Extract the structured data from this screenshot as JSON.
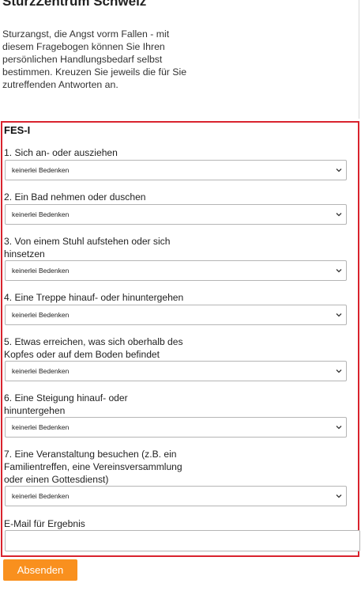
{
  "header": {
    "title": "SturzZentrum Schweiz",
    "intro": "Sturzangst, die Angst vorm Fallen - mit diesem Fragebogen können Sie Ihren persönlichen Handlungsbedarf selbst bestimmen. Kreuzen Sie jeweils die für Sie zutreffenden Antworten an."
  },
  "form": {
    "title": "FES-I",
    "questions": [
      {
        "label": "1. Sich an- oder ausziehen",
        "selected": "keinerlei Bedenken"
      },
      {
        "label": "2. Ein Bad nehmen oder duschen",
        "selected": "keinerlei Bedenken"
      },
      {
        "label": "3. Von einem Stuhl aufstehen oder sich hinsetzen",
        "selected": "keinerlei Bedenken"
      },
      {
        "label": "4. Eine Treppe hinauf- oder hinuntergehen",
        "selected": "keinerlei Bedenken"
      },
      {
        "label": "5. Etwas erreichen, was sich oberhalb des Kopfes oder auf dem Boden befindet",
        "selected": "keinerlei Bedenken"
      },
      {
        "label": "6. Eine Steigung hinauf- oder hinuntergehen",
        "selected": "keinerlei Bedenken"
      },
      {
        "label": "7. Eine Veranstaltung besuchen (z.B. ein Familientreffen, eine Vereinsversammlung oder einen Gottesdienst)",
        "selected": "keinerlei Bedenken"
      }
    ],
    "email_label": "E-Mail für Ergebnis",
    "email_value": "",
    "submit_label": "Absenden"
  },
  "colors": {
    "highlight_border": "#d9232e",
    "submit_button": "#f9901e"
  },
  "icons": {
    "select_arrow": "chevron-down-icon"
  }
}
